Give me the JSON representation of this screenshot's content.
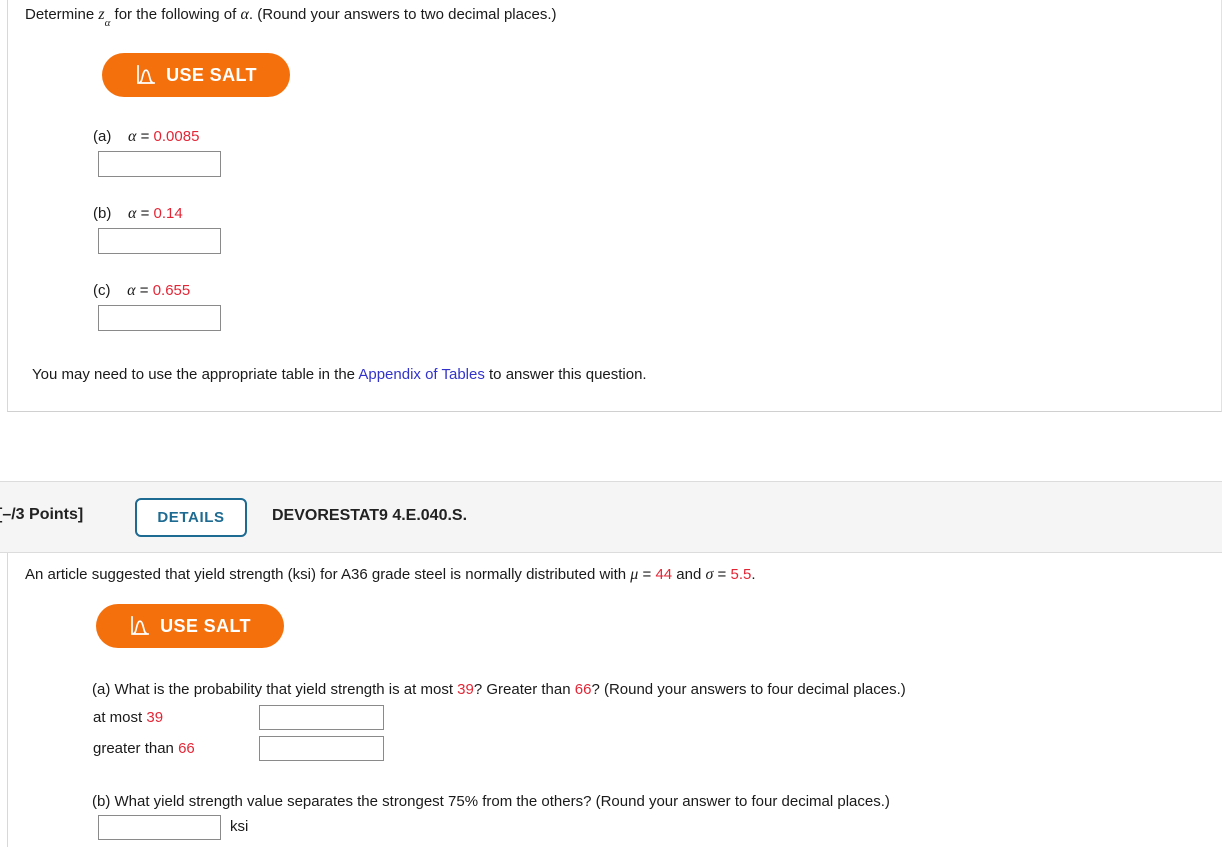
{
  "question1": {
    "prompt_prefix": "Determine ",
    "prompt_var": "z",
    "prompt_sub": "α",
    "prompt_mid": " for the following of ",
    "prompt_alpha": "α",
    "prompt_suffix": ". (Round your answers to two decimal places.)",
    "salt_button_label": "USE SALT",
    "salt_icon": "normal-curve-icon",
    "parts": [
      {
        "tag": "(a)",
        "alpha_symbol": "α",
        "equals": "=",
        "value": "0.0085",
        "answer": ""
      },
      {
        "tag": "(b)",
        "alpha_symbol": "α",
        "equals": "=",
        "value": "0.14",
        "answer": ""
      },
      {
        "tag": "(c)",
        "alpha_symbol": "α",
        "equals": "=",
        "value": "0.655",
        "answer": ""
      }
    ],
    "note_prefix": "You may need to use the appropriate table in the ",
    "note_link": "Appendix of Tables",
    "note_suffix": " to answer this question."
  },
  "question2": {
    "points_label": "[–/3 Points]",
    "details_label": "DETAILS",
    "question_code": "DEVORESTAT9 4.E.040.S.",
    "statement_prefix": "An article suggested that yield strength (ksi) for A36 grade steel is normally distributed with ",
    "statement_mu": "μ",
    "statement_eq1": " = ",
    "statement_mu_value": "44",
    "statement_and": " and ",
    "statement_sigma": "σ",
    "statement_eq2": " = ",
    "statement_sigma_value": "5.5",
    "statement_end": ".",
    "salt_button_label": "USE SALT",
    "salt_icon": "normal-curve-icon",
    "part_a": {
      "text_1": "(a) What is the probability that yield strength is at most ",
      "value_1": "39",
      "text_2": "? Greater than ",
      "value_2": "66",
      "text_3": "? (Round your answers to four decimal places.)",
      "row1_label_prefix": "at most ",
      "row1_label_value": "39",
      "row1_answer": "",
      "row2_label_prefix": "greater than ",
      "row2_label_value": "66",
      "row2_answer": ""
    },
    "part_b": {
      "text": "(b) What yield strength value separates the strongest 75% from the others? (Round your answer to four decimal places.)",
      "answer": "",
      "unit": "ksi"
    }
  },
  "colors": {
    "accent_orange": "#F4700C",
    "value_red": "#E32636",
    "link_blue": "#3333CC",
    "details_teal": "#1D6A92"
  }
}
